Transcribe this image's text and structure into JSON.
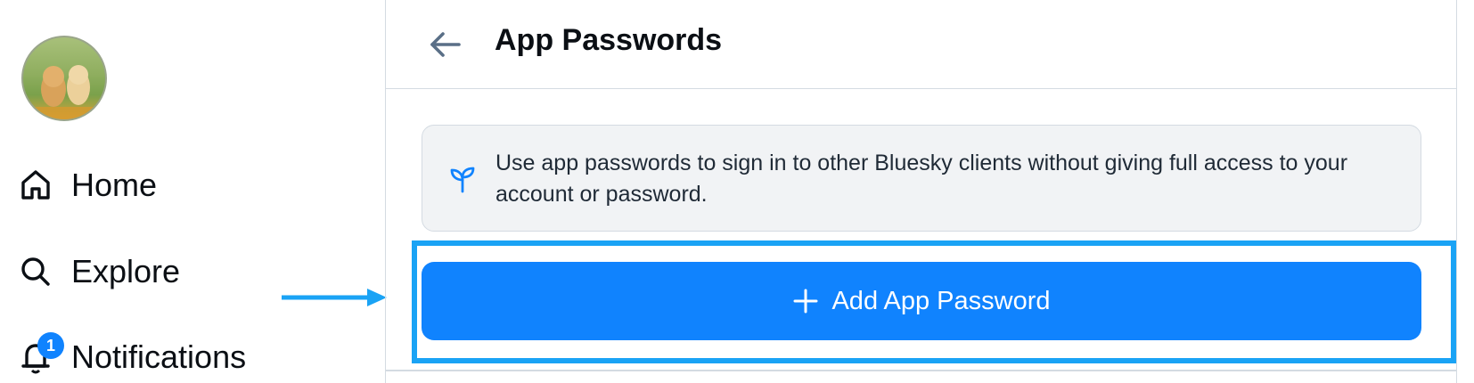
{
  "sidebar": {
    "avatar_alt": "profile avatar",
    "items": [
      {
        "label": "Home",
        "icon": "home-icon"
      },
      {
        "label": "Explore",
        "icon": "search-icon"
      },
      {
        "label": "Notifications",
        "icon": "bell-icon",
        "badge": "1"
      }
    ]
  },
  "header": {
    "title": "App Passwords",
    "back_icon": "arrow-left-icon"
  },
  "info": {
    "icon": "sprout-icon",
    "text": "Use app passwords to sign in to other Bluesky clients without giving full access to your account or password."
  },
  "action": {
    "add_label": "Add App Password",
    "icon": "plus-icon"
  },
  "colors": {
    "accent": "#1083fe",
    "highlight": "#1aa3f5",
    "border": "#d4dbe2",
    "info_bg": "#f1f3f5"
  }
}
